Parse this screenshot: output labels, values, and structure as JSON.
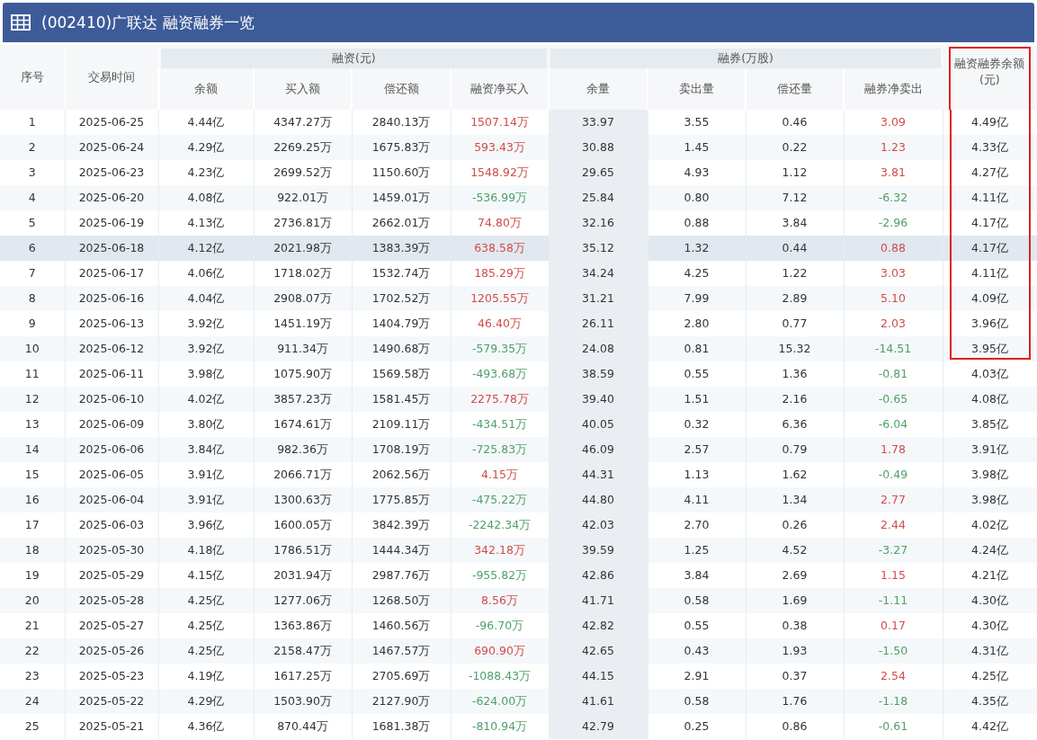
{
  "title": "(002410)广联达 融资融券一览",
  "header": {
    "index": "序号",
    "date": "交易时间",
    "groups": [
      {
        "label": "融资(元)",
        "columns": [
          "余额",
          "买入额",
          "偿还额",
          "融资净买入"
        ]
      },
      {
        "label": "融券(万股)",
        "columns": [
          "余量",
          "卖出量",
          "偿还量",
          "融券净卖出"
        ]
      }
    ],
    "total": "融资融券余额(元)"
  },
  "rows": [
    {
      "cells": [
        "1",
        "2025-06-25",
        "4.44亿",
        "4347.27万",
        "2840.13万",
        "1507.14万",
        "33.97",
        "3.55",
        "0.46",
        "3.09",
        "4.49亿"
      ],
      "net_buy_up": true,
      "net_sell_up": true,
      "selected": false,
      "boxed": true
    },
    {
      "cells": [
        "2",
        "2025-06-24",
        "4.29亿",
        "2269.25万",
        "1675.83万",
        "593.43万",
        "30.88",
        "1.45",
        "0.22",
        "1.23",
        "4.33亿"
      ],
      "net_buy_up": true,
      "net_sell_up": true,
      "selected": false,
      "boxed": true
    },
    {
      "cells": [
        "3",
        "2025-06-23",
        "4.23亿",
        "2699.52万",
        "1150.60万",
        "1548.92万",
        "29.65",
        "4.93",
        "1.12",
        "3.81",
        "4.27亿"
      ],
      "net_buy_up": true,
      "net_sell_up": true,
      "selected": false,
      "boxed": true
    },
    {
      "cells": [
        "4",
        "2025-06-20",
        "4.08亿",
        "922.01万",
        "1459.01万",
        "-536.99万",
        "25.84",
        "0.80",
        "7.12",
        "-6.32",
        "4.11亿"
      ],
      "net_buy_up": false,
      "net_sell_up": false,
      "selected": false,
      "boxed": true
    },
    {
      "cells": [
        "5",
        "2025-06-19",
        "4.13亿",
        "2736.81万",
        "2662.01万",
        "74.80万",
        "32.16",
        "0.88",
        "3.84",
        "-2.96",
        "4.17亿"
      ],
      "net_buy_up": true,
      "net_sell_up": false,
      "selected": false,
      "boxed": true
    },
    {
      "cells": [
        "6",
        "2025-06-18",
        "4.12亿",
        "2021.98万",
        "1383.39万",
        "638.58万",
        "35.12",
        "1.32",
        "0.44",
        "0.88",
        "4.17亿"
      ],
      "net_buy_up": true,
      "net_sell_up": true,
      "selected": true,
      "boxed": true
    },
    {
      "cells": [
        "7",
        "2025-06-17",
        "4.06亿",
        "1718.02万",
        "1532.74万",
        "185.29万",
        "34.24",
        "4.25",
        "1.22",
        "3.03",
        "4.11亿"
      ],
      "net_buy_up": true,
      "net_sell_up": true,
      "selected": false,
      "boxed": true
    },
    {
      "cells": [
        "8",
        "2025-06-16",
        "4.04亿",
        "2908.07万",
        "1702.52万",
        "1205.55万",
        "31.21",
        "7.99",
        "2.89",
        "5.10",
        "4.09亿"
      ],
      "net_buy_up": true,
      "net_sell_up": true,
      "selected": false,
      "boxed": true
    },
    {
      "cells": [
        "9",
        "2025-06-13",
        "3.92亿",
        "1451.19万",
        "1404.79万",
        "46.40万",
        "26.11",
        "2.80",
        "0.77",
        "2.03",
        "3.96亿"
      ],
      "net_buy_up": true,
      "net_sell_up": true,
      "selected": false,
      "boxed": true
    },
    {
      "cells": [
        "10",
        "2025-06-12",
        "3.92亿",
        "911.34万",
        "1490.68万",
        "-579.35万",
        "24.08",
        "0.81",
        "15.32",
        "-14.51",
        "3.95亿"
      ],
      "net_buy_up": false,
      "net_sell_up": false,
      "selected": false,
      "boxed": true
    },
    {
      "cells": [
        "11",
        "2025-06-11",
        "3.98亿",
        "1075.90万",
        "1569.58万",
        "-493.68万",
        "38.59",
        "0.55",
        "1.36",
        "-0.81",
        "4.03亿"
      ],
      "net_buy_up": false,
      "net_sell_up": false,
      "selected": false,
      "boxed": false
    },
    {
      "cells": [
        "12",
        "2025-06-10",
        "4.02亿",
        "3857.23万",
        "1581.45万",
        "2275.78万",
        "39.40",
        "1.51",
        "2.16",
        "-0.65",
        "4.08亿"
      ],
      "net_buy_up": true,
      "net_sell_up": false,
      "selected": false,
      "boxed": false
    },
    {
      "cells": [
        "13",
        "2025-06-09",
        "3.80亿",
        "1674.61万",
        "2109.11万",
        "-434.51万",
        "40.05",
        "0.32",
        "6.36",
        "-6.04",
        "3.85亿"
      ],
      "net_buy_up": false,
      "net_sell_up": false,
      "selected": false,
      "boxed": false
    },
    {
      "cells": [
        "14",
        "2025-06-06",
        "3.84亿",
        "982.36万",
        "1708.19万",
        "-725.83万",
        "46.09",
        "2.57",
        "0.79",
        "1.78",
        "3.91亿"
      ],
      "net_buy_up": false,
      "net_sell_up": true,
      "selected": false,
      "boxed": false
    },
    {
      "cells": [
        "15",
        "2025-06-05",
        "3.91亿",
        "2066.71万",
        "2062.56万",
        "4.15万",
        "44.31",
        "1.13",
        "1.62",
        "-0.49",
        "3.98亿"
      ],
      "net_buy_up": true,
      "net_sell_up": false,
      "selected": false,
      "boxed": false
    },
    {
      "cells": [
        "16",
        "2025-06-04",
        "3.91亿",
        "1300.63万",
        "1775.85万",
        "-475.22万",
        "44.80",
        "4.11",
        "1.34",
        "2.77",
        "3.98亿"
      ],
      "net_buy_up": false,
      "net_sell_up": true,
      "selected": false,
      "boxed": false
    },
    {
      "cells": [
        "17",
        "2025-06-03",
        "3.96亿",
        "1600.05万",
        "3842.39万",
        "-2242.34万",
        "42.03",
        "2.70",
        "0.26",
        "2.44",
        "4.02亿"
      ],
      "net_buy_up": false,
      "net_sell_up": true,
      "selected": false,
      "boxed": false
    },
    {
      "cells": [
        "18",
        "2025-05-30",
        "4.18亿",
        "1786.51万",
        "1444.34万",
        "342.18万",
        "39.59",
        "1.25",
        "4.52",
        "-3.27",
        "4.24亿"
      ],
      "net_buy_up": true,
      "net_sell_up": false,
      "selected": false,
      "boxed": false
    },
    {
      "cells": [
        "19",
        "2025-05-29",
        "4.15亿",
        "2031.94万",
        "2987.76万",
        "-955.82万",
        "42.86",
        "3.84",
        "2.69",
        "1.15",
        "4.21亿"
      ],
      "net_buy_up": false,
      "net_sell_up": true,
      "selected": false,
      "boxed": false
    },
    {
      "cells": [
        "20",
        "2025-05-28",
        "4.25亿",
        "1277.06万",
        "1268.50万",
        "8.56万",
        "41.71",
        "0.58",
        "1.69",
        "-1.11",
        "4.30亿"
      ],
      "net_buy_up": true,
      "net_sell_up": false,
      "selected": false,
      "boxed": false
    },
    {
      "cells": [
        "21",
        "2025-05-27",
        "4.25亿",
        "1363.86万",
        "1460.56万",
        "-96.70万",
        "42.82",
        "0.55",
        "0.38",
        "0.17",
        "4.30亿"
      ],
      "net_buy_up": false,
      "net_sell_up": true,
      "selected": false,
      "boxed": false
    },
    {
      "cells": [
        "22",
        "2025-05-26",
        "4.25亿",
        "2158.47万",
        "1467.57万",
        "690.90万",
        "42.65",
        "0.43",
        "1.93",
        "-1.50",
        "4.31亿"
      ],
      "net_buy_up": true,
      "net_sell_up": false,
      "selected": false,
      "boxed": false
    },
    {
      "cells": [
        "23",
        "2025-05-23",
        "4.19亿",
        "1617.25万",
        "2705.69万",
        "-1088.43万",
        "44.15",
        "2.91",
        "0.37",
        "2.54",
        "4.25亿"
      ],
      "net_buy_up": false,
      "net_sell_up": true,
      "selected": false,
      "boxed": false
    },
    {
      "cells": [
        "24",
        "2025-05-22",
        "4.29亿",
        "1503.90万",
        "2127.90万",
        "-624.00万",
        "41.61",
        "0.58",
        "1.76",
        "-1.18",
        "4.35亿"
      ],
      "net_buy_up": false,
      "net_sell_up": false,
      "selected": false,
      "boxed": false
    },
    {
      "cells": [
        "25",
        "2025-05-21",
        "4.36亿",
        "870.44万",
        "1681.38万",
        "-810.94万",
        "42.79",
        "0.25",
        "0.86",
        "-0.61",
        "4.42亿"
      ],
      "net_buy_up": false,
      "net_sell_up": false,
      "selected": false,
      "boxed": false
    }
  ]
}
